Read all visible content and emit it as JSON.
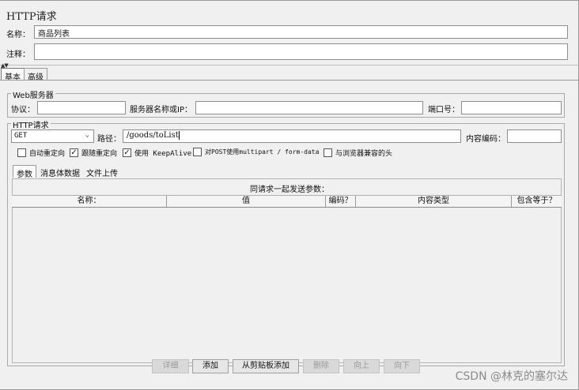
{
  "header": {
    "title": "HTTP请求",
    "name_label": "名称：",
    "name_value": "商品列表",
    "comment_label": "注释：",
    "comment_value": ""
  },
  "main_tabs": [
    {
      "label": "基本",
      "active": true
    },
    {
      "label": "高级",
      "active": false
    }
  ],
  "web_server": {
    "group_title": "Web服务器",
    "protocol_label": "协议：",
    "protocol_value": "",
    "server_label": "服务器名称或IP：",
    "server_value": "",
    "port_label": "端口号：",
    "port_value": ""
  },
  "http_request": {
    "group_title": "HTTP请求",
    "method": "GET",
    "path_label": "路径：",
    "path_value": "/goods/toList",
    "encoding_label": "内容编码：",
    "encoding_value": ""
  },
  "checkboxes": [
    {
      "label": "自动重定向",
      "checked": false
    },
    {
      "label": "跟随重定向",
      "checked": true
    },
    {
      "label": "使用 KeepAlive",
      "checked": true
    },
    {
      "label": "对POST使用multipart / form-data",
      "checked": false
    },
    {
      "label": "与浏览器兼容的头",
      "checked": false
    }
  ],
  "sub_tabs": [
    {
      "label": "参数",
      "active": true
    },
    {
      "label": "消息体数据",
      "active": false
    },
    {
      "label": "文件上传",
      "active": false
    }
  ],
  "params_table": {
    "caption": "同请求一起发送参数：",
    "columns": [
      "名称：",
      "值",
      "编码？",
      "内容类型",
      "包含等于？"
    ]
  },
  "buttons": [
    {
      "label": "详细",
      "enabled": false
    },
    {
      "label": "添加",
      "enabled": true
    },
    {
      "label": "从剪贴板添加",
      "enabled": true
    },
    {
      "label": "删除",
      "enabled": false
    },
    {
      "label": "向上",
      "enabled": false
    },
    {
      "label": "向下",
      "enabled": false
    }
  ],
  "watermark": "CSDN @林克的塞尔达",
  "icons": {
    "collapse": "collapse-arrows-icon",
    "dropdown": "chevron-down-icon",
    "check": "checkmark-icon"
  }
}
